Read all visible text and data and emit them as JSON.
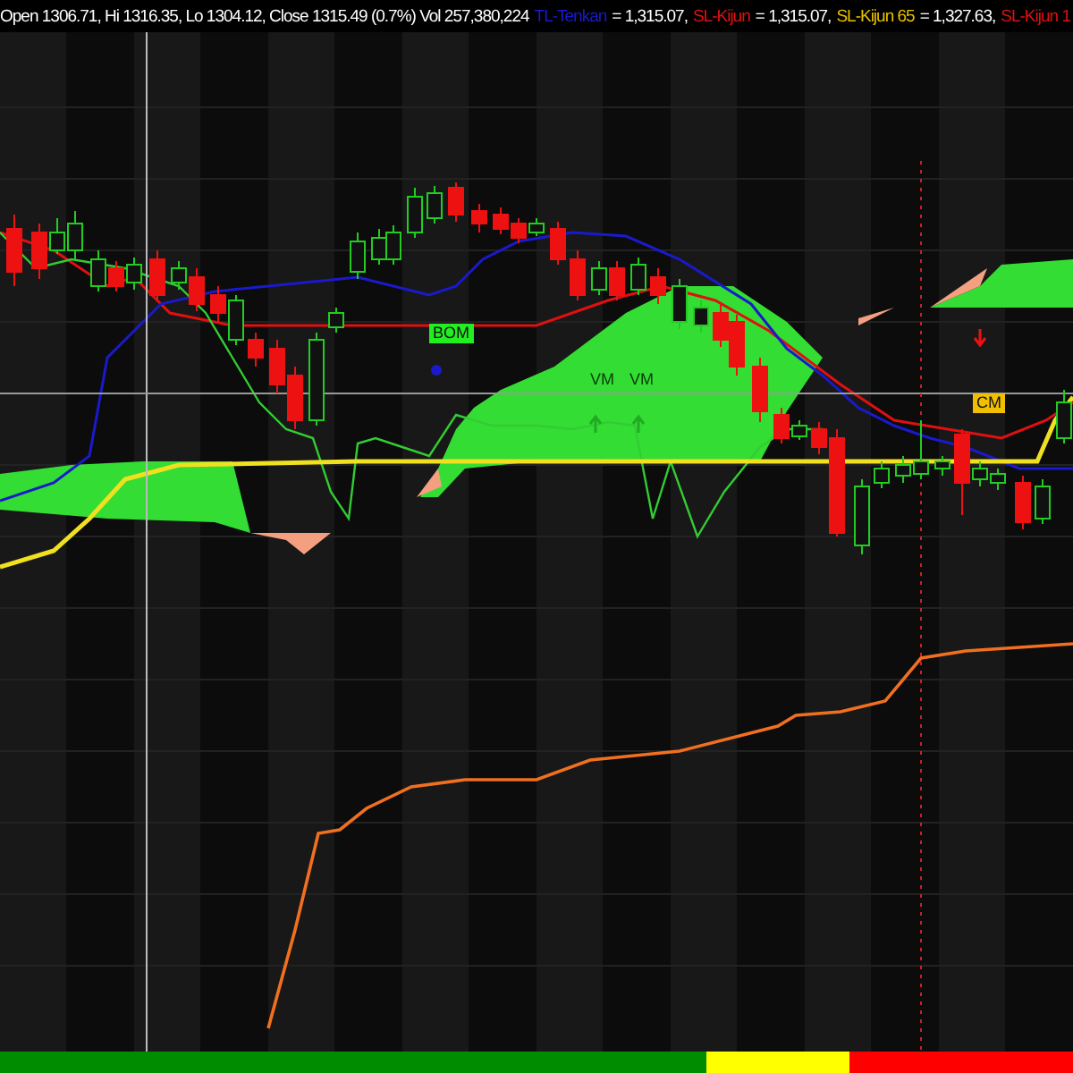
{
  "quote": "Open 1306.71, Hi 1316.35, Lo 1304.12, Close 1315.49 (0.7%) Vol 257,380,224",
  "legend": [
    {
      "name": "TL-Tenkan",
      "color": "#1a1acc",
      "value": "= 1,315.07,"
    },
    {
      "name": "SL-Kijun",
      "color": "#e01010",
      "value": "= 1,315.07,"
    },
    {
      "name": "SL-Kijun 65",
      "color": "#e8c000",
      "value": "= 1,327.63,"
    },
    {
      "name": "SL-Kijun 1",
      "color": "#e01010"
    }
  ],
  "signals": [
    {
      "text": "BOM",
      "kind": "box",
      "color": "#22ee22"
    },
    {
      "text": "VM",
      "kind": "plain"
    },
    {
      "text": "VM",
      "kind": "plain"
    },
    {
      "text": "CM",
      "kind": "box",
      "color": "#f0c000"
    }
  ],
  "trend_bar": [
    {
      "color": "#008c00"
    },
    {
      "color": "#ffff00"
    },
    {
      "color": "#ff0000"
    }
  ]
}
